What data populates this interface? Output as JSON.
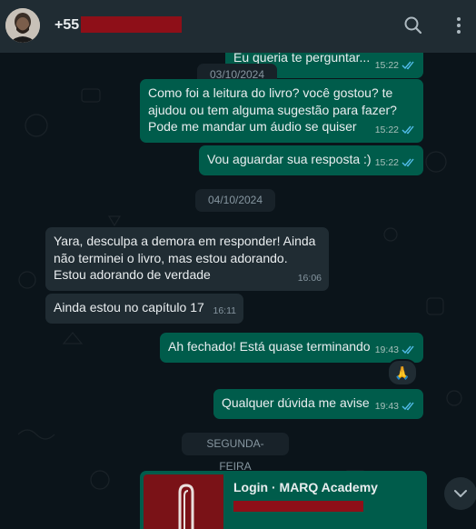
{
  "header": {
    "contact_title": "+55",
    "icons": [
      "search-icon",
      "menu-dots-icon"
    ]
  },
  "messages": {
    "m0": {
      "text": "Eu queria te perguntar...",
      "time": "15:22"
    },
    "d1": "03/10/2024",
    "m1": {
      "text": "Como foi a leitura do livro? você gostou? te ajudou ou tem alguma sugestão para fazer? Pode me mandar um áudio se quiser",
      "time": "15:22"
    },
    "m2": {
      "text": "Vou aguardar sua resposta :)",
      "time": "15:22"
    },
    "d2": "04/10/2024",
    "m3": {
      "text": "Yara, desculpa a demora em responder! Ainda não terminei o livro, mas estou adorando. Estou adorando de verdade",
      "time": "16:06"
    },
    "m4": {
      "text": "Ainda estou no capítulo 17",
      "time": "16:11"
    },
    "m5": {
      "text": "Ah fechado! Está quase terminando",
      "time": "19:43",
      "reaction": "🙏"
    },
    "m6": {
      "text": "Qualquer dúvida me avise",
      "time": "19:43"
    },
    "d3": "SEGUNDA-FEIRA",
    "link_card": {
      "title": "Login · MARQ Academy"
    }
  },
  "colors": {
    "outgoing": "#005c4b",
    "incoming": "#202c33",
    "read_tick": "#53bdeb",
    "redaction": "#8e0f18"
  }
}
